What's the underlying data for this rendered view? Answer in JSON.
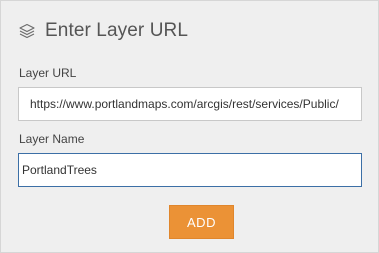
{
  "dialog": {
    "title": "Enter Layer URL",
    "title_icon": "layers-icon"
  },
  "layer_url": {
    "label": "Layer URL",
    "value": "https://www.portlandmaps.com/arcgis/rest/services/Public/",
    "placeholder": ""
  },
  "layer_name": {
    "label": "Layer Name",
    "value": "PortlandTrees",
    "placeholder": ""
  },
  "actions": {
    "add_label": "ADD"
  },
  "colors": {
    "panel_background": "#efefef",
    "accent_button": "#eb9236",
    "focus_border": "#3c6fa6"
  }
}
